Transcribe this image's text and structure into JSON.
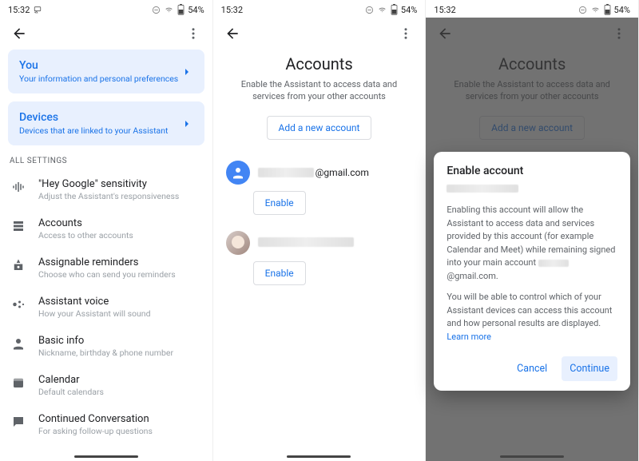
{
  "status": {
    "time": "15:32",
    "battery": "54%"
  },
  "screen1": {
    "cards": {
      "you": {
        "title": "You",
        "sub": "Your information and personal preferences"
      },
      "devices": {
        "title": "Devices",
        "sub": "Devices that are linked to your Assistant"
      }
    },
    "sectionHeader": "ALL SETTINGS",
    "items": [
      {
        "title": "\"Hey Google\" sensitivity",
        "sub": "Adjust the Assistant's responsiveness"
      },
      {
        "title": "Accounts",
        "sub": "Access to other accounts"
      },
      {
        "title": "Assignable reminders",
        "sub": "Choose who can send you reminders"
      },
      {
        "title": "Assistant voice",
        "sub": "How your Assistant will sound"
      },
      {
        "title": "Basic info",
        "sub": "Nickname, birthday & phone number"
      },
      {
        "title": "Calendar",
        "sub": "Default calendars"
      },
      {
        "title": "Continued Conversation",
        "sub": "For asking follow-up questions"
      }
    ]
  },
  "screen2": {
    "title": "Accounts",
    "sub": "Enable the Assistant to access data and services from your other accounts",
    "addBtn": "Add a new account",
    "enableBtn": "Enable",
    "account1Suffix": "@gmail.com"
  },
  "screen3": {
    "title": "Accounts",
    "sub": "Enable the Assistant to access data and services from your other accounts",
    "addBtn": "Add a new account",
    "dialog": {
      "title": "Enable account",
      "p1a": "Enabling this account will allow the Assistant to access data and services provided by this account (for example Calendar and Meet) while remaining signed into your main account ",
      "p1b": "@gmail.com.",
      "p2": "You will be able to control which of your Assistant devices can access this account and how personal results are displayed. ",
      "learn": "Learn more",
      "cancel": "Cancel",
      "continue": "Continue"
    }
  }
}
